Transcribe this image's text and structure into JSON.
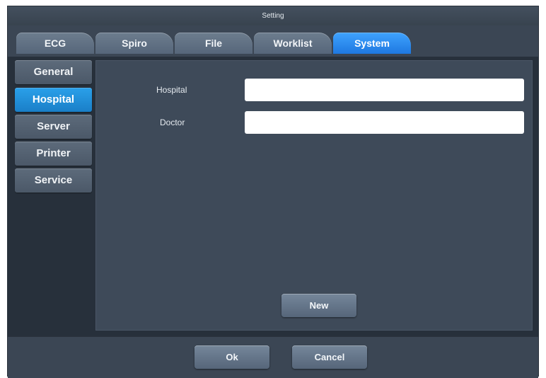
{
  "window": {
    "title": "Setting"
  },
  "tabs": [
    {
      "label": "ECG",
      "active": false
    },
    {
      "label": "Spiro",
      "active": false
    },
    {
      "label": "File",
      "active": false
    },
    {
      "label": "Worklist",
      "active": false
    },
    {
      "label": "System",
      "active": true
    }
  ],
  "sidebar": {
    "items": [
      {
        "label": "General",
        "active": false
      },
      {
        "label": "Hospital",
        "active": true
      },
      {
        "label": "Server",
        "active": false
      },
      {
        "label": "Printer",
        "active": false
      },
      {
        "label": "Service",
        "active": false
      }
    ]
  },
  "form": {
    "hospital_label": "Hospital",
    "hospital_value": "",
    "doctor_label": "Doctor",
    "doctor_value": "",
    "new_label": "New"
  },
  "footer": {
    "ok_label": "Ok",
    "cancel_label": "Cancel"
  },
  "colors": {
    "accent": "#1e78e0",
    "sidebar_active": "#1a7fc8",
    "background": "#3b4654"
  }
}
